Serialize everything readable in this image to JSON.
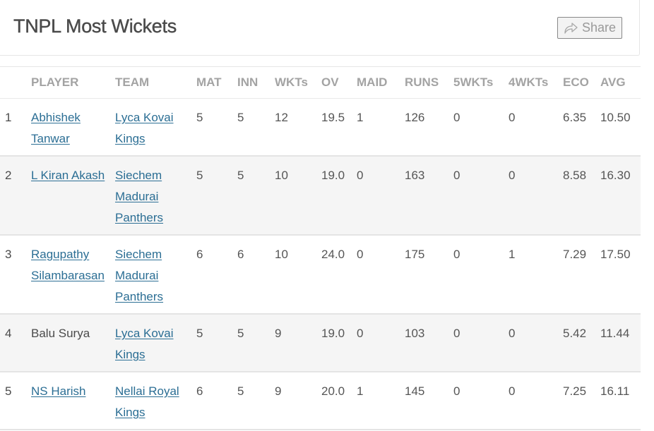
{
  "header": {
    "title": "TNPL Most Wickets",
    "share_label": "Share",
    "share_icon": "share-arrow-icon"
  },
  "colors": {
    "link": "#2b6e94",
    "header_text": "#a3a3a3",
    "alt_row_bg": "#f5f5f5"
  },
  "table": {
    "columns": [
      "",
      "PLAYER",
      "TEAM",
      "MAT",
      "INN",
      "WKTs",
      "OV",
      "MAID",
      "RUNS",
      "5WKTs",
      "4WKTs",
      "ECO",
      "AVG"
    ],
    "rows": [
      {
        "rank": "1",
        "player": "Abhishek Tanwar",
        "player_linked": true,
        "team": "Lyca Kovai Kings",
        "mat": "5",
        "inn": "5",
        "wkts": "12",
        "ov": "19.5",
        "maid": "1",
        "runs": "126",
        "fivew": "0",
        "fourw": "0",
        "eco": "6.35",
        "avg": "10.50"
      },
      {
        "rank": "2",
        "player": "L Kiran Akash",
        "player_linked": true,
        "team": "Siechem Madurai Panthers",
        "mat": "5",
        "inn": "5",
        "wkts": "10",
        "ov": "19.0",
        "maid": "0",
        "runs": "163",
        "fivew": "0",
        "fourw": "0",
        "eco": "8.58",
        "avg": "16.30"
      },
      {
        "rank": "3",
        "player": "Ragupathy Silambarasan",
        "player_linked": true,
        "team": "Siechem Madurai Panthers",
        "mat": "6",
        "inn": "6",
        "wkts": "10",
        "ov": "24.0",
        "maid": "0",
        "runs": "175",
        "fivew": "0",
        "fourw": "1",
        "eco": "7.29",
        "avg": "17.50"
      },
      {
        "rank": "4",
        "player": "Balu Surya",
        "player_linked": false,
        "team": "Lyca Kovai Kings",
        "mat": "5",
        "inn": "5",
        "wkts": "9",
        "ov": "19.0",
        "maid": "0",
        "runs": "103",
        "fivew": "0",
        "fourw": "0",
        "eco": "5.42",
        "avg": "11.44"
      },
      {
        "rank": "5",
        "player": "NS Harish",
        "player_linked": true,
        "team": "Nellai Royal Kings",
        "mat": "6",
        "inn": "5",
        "wkts": "9",
        "ov": "20.0",
        "maid": "1",
        "runs": "145",
        "fivew": "0",
        "fourw": "0",
        "eco": "7.25",
        "avg": "16.11"
      }
    ]
  }
}
